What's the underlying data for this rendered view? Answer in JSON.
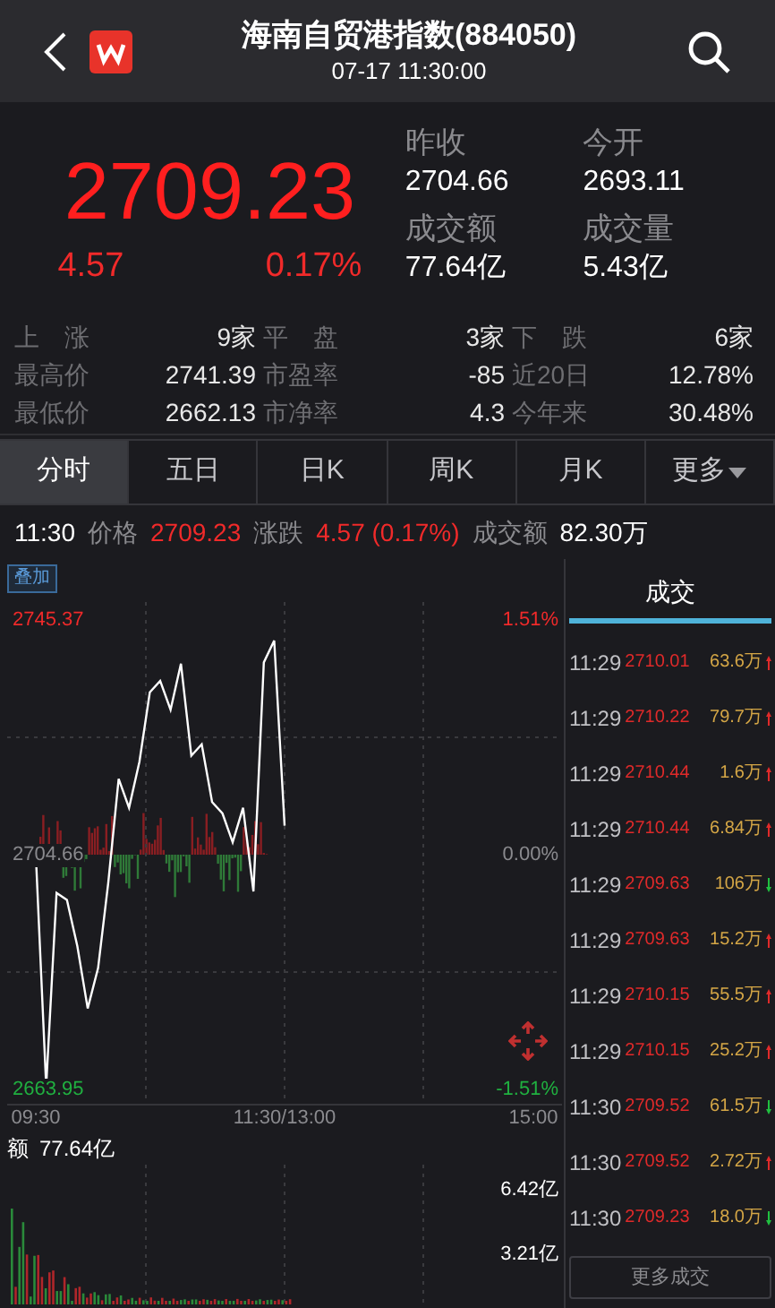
{
  "header": {
    "title": "海南自贸港指数(884050)",
    "subtitle": "07-17 11:30:00"
  },
  "quote": {
    "price": "2709.23",
    "change": "4.57",
    "change_pct": "0.17%",
    "fields": [
      {
        "label": "昨收",
        "value": "2704.66"
      },
      {
        "label": "今开",
        "value": "2693.11"
      },
      {
        "label": "成交额",
        "value": "77.64亿"
      },
      {
        "label": "成交量",
        "value": "5.43亿"
      }
    ]
  },
  "stats": [
    {
      "label": "上　涨",
      "value": "9家"
    },
    {
      "label": "平　盘",
      "value": "3家"
    },
    {
      "label": "下　跌",
      "value": "6家"
    },
    {
      "label": "最高价",
      "value": "2741.39"
    },
    {
      "label": "市盈率",
      "value": "-85"
    },
    {
      "label": "近20日",
      "value": "12.78%"
    },
    {
      "label": "最低价",
      "value": "2662.13"
    },
    {
      "label": "市净率",
      "value": "4.3"
    },
    {
      "label": "今年来",
      "value": "30.48%"
    }
  ],
  "tabs": [
    {
      "label": "分时",
      "selected": true
    },
    {
      "label": "五日",
      "selected": false
    },
    {
      "label": "日K",
      "selected": false
    },
    {
      "label": "周K",
      "selected": false
    },
    {
      "label": "月K",
      "selected": false
    },
    {
      "label": "更多",
      "selected": false,
      "dropdown": true
    }
  ],
  "info_line": [
    {
      "text": "11:30",
      "kind": "plain"
    },
    {
      "text": "价格",
      "kind": "label"
    },
    {
      "text": "2709.23",
      "kind": "rise"
    },
    {
      "text": "涨跌",
      "kind": "label"
    },
    {
      "text": "4.57 (0.17%)",
      "kind": "rise"
    },
    {
      "text": "成交额",
      "kind": "label"
    },
    {
      "text": "82.30万",
      "kind": "plain"
    }
  ],
  "overlay_button": "叠加",
  "price_chart": {
    "percent_labels": [
      "1.51%",
      "0.00%",
      "-1.51%"
    ],
    "chart_data": {
      "type": "line",
      "categories": [
        "09:30",
        null,
        null,
        null,
        null,
        null,
        null,
        null,
        null,
        null,
        null,
        null,
        null,
        null,
        null,
        null,
        null,
        null,
        null,
        null,
        null,
        null,
        null,
        null,
        "11:30/13:00",
        null,
        null,
        null,
        null,
        null,
        null,
        null,
        null,
        null,
        null,
        null,
        null,
        null,
        null,
        null,
        null,
        null,
        null,
        null,
        null,
        null,
        null,
        null,
        "15:00"
      ],
      "series": [
        {
          "color": "#ffffff",
          "values": [
            2704.7,
            2664.5,
            2698.0,
            2696.8,
            2688.8,
            2678.0,
            2685.0,
            2699.8,
            2717.8,
            2712.8,
            2720.8,
            2732.8,
            2734.8,
            2729.8,
            2737.8,
            2721.8,
            2723.8,
            2713.8,
            2711.8,
            2706.8,
            2712.8,
            2698.3,
            2738.0,
            2741.8,
            2709.7,
            null,
            null,
            null,
            null,
            null,
            null,
            null,
            null,
            null,
            null,
            null,
            null,
            null,
            null,
            null,
            null,
            null,
            null,
            null,
            null,
            null,
            null,
            null,
            null
          ]
        }
      ],
      "ylim": [
        2663.95,
        2745.37
      ],
      "yticks": [
        {
          "value": 2745.37,
          "label": "2745.37"
        },
        {
          "value": 2704.66,
          "label": "2704.66"
        },
        {
          "value": 2663.95,
          "label": "2663.95"
        }
      ]
    }
  },
  "volume_chart": {
    "label": "额",
    "total": "77.64亿",
    "axis_labels": [
      "6.42亿",
      "3.21亿"
    ]
  },
  "trades_tab": {
    "label": "成交",
    "selected": true
  },
  "trades": [
    {
      "time": "11:29",
      "price": "2710.01",
      "volume": "63.6万",
      "kind": "up"
    },
    {
      "time": "11:29",
      "price": "2710.22",
      "volume": "79.7万",
      "kind": "up"
    },
    {
      "time": "11:29",
      "price": "2710.44",
      "volume": "1.6万",
      "kind": "up"
    },
    {
      "time": "11:29",
      "price": "2710.44",
      "volume": "6.84万",
      "kind": "up"
    },
    {
      "time": "11:29",
      "price": "2709.63",
      "volume": "106万",
      "kind": "down"
    },
    {
      "time": "11:29",
      "price": "2709.63",
      "volume": "15.2万",
      "kind": "up"
    },
    {
      "time": "11:29",
      "price": "2710.15",
      "volume": "55.5万",
      "kind": "up"
    },
    {
      "time": "11:29",
      "price": "2710.15",
      "volume": "25.2万",
      "kind": "up"
    },
    {
      "time": "11:30",
      "price": "2709.52",
      "volume": "61.5万",
      "kind": "down"
    },
    {
      "time": "11:30",
      "price": "2709.52",
      "volume": "2.72万",
      "kind": "up"
    },
    {
      "time": "11:30",
      "price": "2709.23",
      "volume": "18.0万",
      "kind": "down"
    }
  ],
  "more_trades_button": "更多成交"
}
